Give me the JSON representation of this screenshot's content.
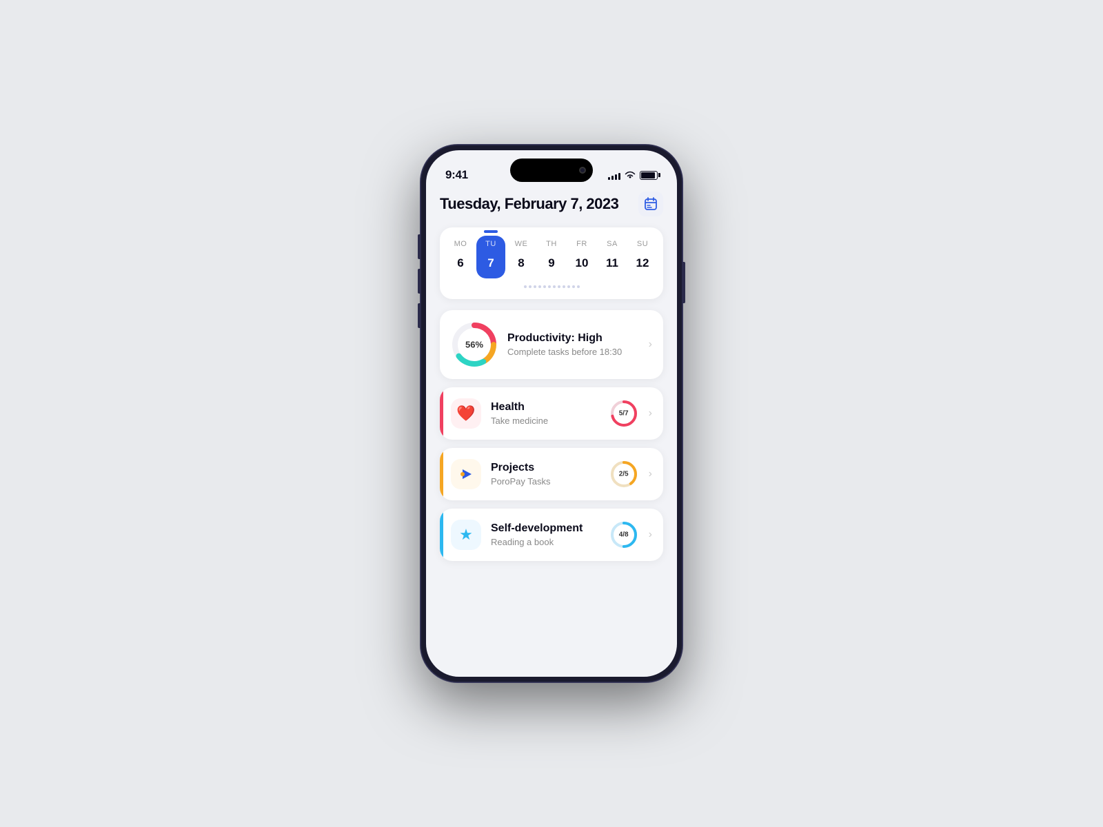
{
  "phone": {
    "status_bar": {
      "time": "9:41",
      "signal_bars": [
        4,
        6,
        8,
        10,
        12
      ],
      "wifi": "wifi",
      "battery": 90
    },
    "header": {
      "title": "Tuesday, February 7, 2023",
      "calendar_btn_label": "calendar"
    },
    "calendar": {
      "days": [
        {
          "label": "MO",
          "number": "6",
          "active": false
        },
        {
          "label": "TU",
          "number": "7",
          "active": true
        },
        {
          "label": "WE",
          "number": "8",
          "active": false
        },
        {
          "label": "TH",
          "number": "9",
          "active": false
        },
        {
          "label": "FR",
          "number": "10",
          "active": false
        },
        {
          "label": "SA",
          "number": "11",
          "active": false
        },
        {
          "label": "SU",
          "number": "12",
          "active": false
        }
      ],
      "dots": [
        1,
        2,
        3,
        4,
        5,
        6,
        7,
        8,
        9,
        10,
        11,
        12
      ]
    },
    "productivity": {
      "percent": "56%",
      "title": "Productivity: High",
      "subtitle": "Complete tasks before 18:30",
      "value": 56,
      "colors": {
        "red": "#f04060",
        "orange": "#f5a623",
        "blue": "#2dd4d4"
      }
    },
    "tasks": [
      {
        "id": "health",
        "accent_color": "#f04060",
        "icon": "❤️",
        "icon_bg": "#fff0f2",
        "title": "Health",
        "subtitle": "Take medicine",
        "progress_current": 5,
        "progress_total": 7,
        "progress_label": "5/7",
        "progress_color": "#f04060",
        "progress_bg": "#f0d0d8"
      },
      {
        "id": "projects",
        "accent_color": "#f5a623",
        "icon": "▶",
        "icon_bg": "#fff8ec",
        "title": "Projects",
        "subtitle": "PoroPay Tasks",
        "progress_current": 2,
        "progress_total": 5,
        "progress_label": "2/5",
        "progress_color": "#f5a623",
        "progress_bg": "#f0e0c0"
      },
      {
        "id": "self-development",
        "accent_color": "#2db8f0",
        "icon": "⭐",
        "icon_bg": "#eef8ff",
        "title": "Self-development",
        "subtitle": "Reading a book",
        "progress_current": 4,
        "progress_total": 8,
        "progress_label": "4/8",
        "progress_color": "#2db8f0",
        "progress_bg": "#c8e8f8"
      }
    ]
  }
}
